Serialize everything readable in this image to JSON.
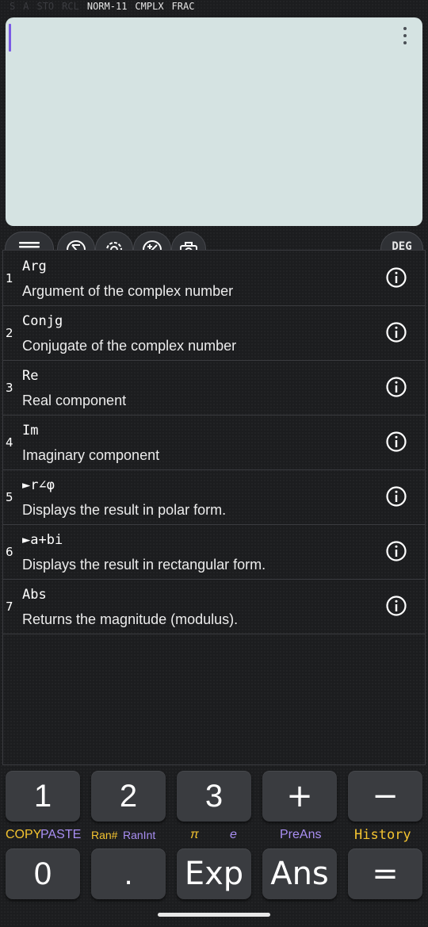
{
  "status": {
    "dim_indicators": [
      "S",
      "A",
      "STO",
      "RCL"
    ],
    "active_indicators": [
      "NORM-11",
      "CMPLX",
      "FRAC"
    ]
  },
  "toolbar": {
    "angle_mode": "DEG",
    "icons": [
      "menu-icon",
      "sigma-icon",
      "settings-icon",
      "plus-minus-icon",
      "camera-icon"
    ]
  },
  "functions": [
    {
      "num": "1",
      "title": "Arg",
      "desc": "Argument of the complex number"
    },
    {
      "num": "2",
      "title": "Conjg",
      "desc": "Conjugate of the complex number"
    },
    {
      "num": "3",
      "title": "Re",
      "desc": "Real component"
    },
    {
      "num": "4",
      "title": "Im",
      "desc": "Imaginary component"
    },
    {
      "num": "5",
      "title": "►r∠φ",
      "desc": "Displays the result in polar form."
    },
    {
      "num": "6",
      "title": "►a+bi",
      "desc": "Displays the result in rectangular form."
    },
    {
      "num": "7",
      "title": "Abs",
      "desc": "Returns the magnitude (modulus)."
    }
  ],
  "keypad": {
    "row1": [
      "1",
      "2",
      "3",
      "+",
      "−"
    ],
    "row2": [
      "0",
      ".",
      "Exp",
      "Ans",
      "="
    ],
    "secondary": {
      "copy": "COPY",
      "paste": "PASTE",
      "ran": "Ran#",
      "ranint": "RanInt",
      "pi": "π",
      "e": "e",
      "preans": "PreAns",
      "history": "History"
    }
  },
  "colors": {
    "display_bg": "#d5e3e2",
    "cursor": "#7a5ae6",
    "shift_yellow": "#f4c430",
    "alpha_purple": "#a98ff3"
  }
}
